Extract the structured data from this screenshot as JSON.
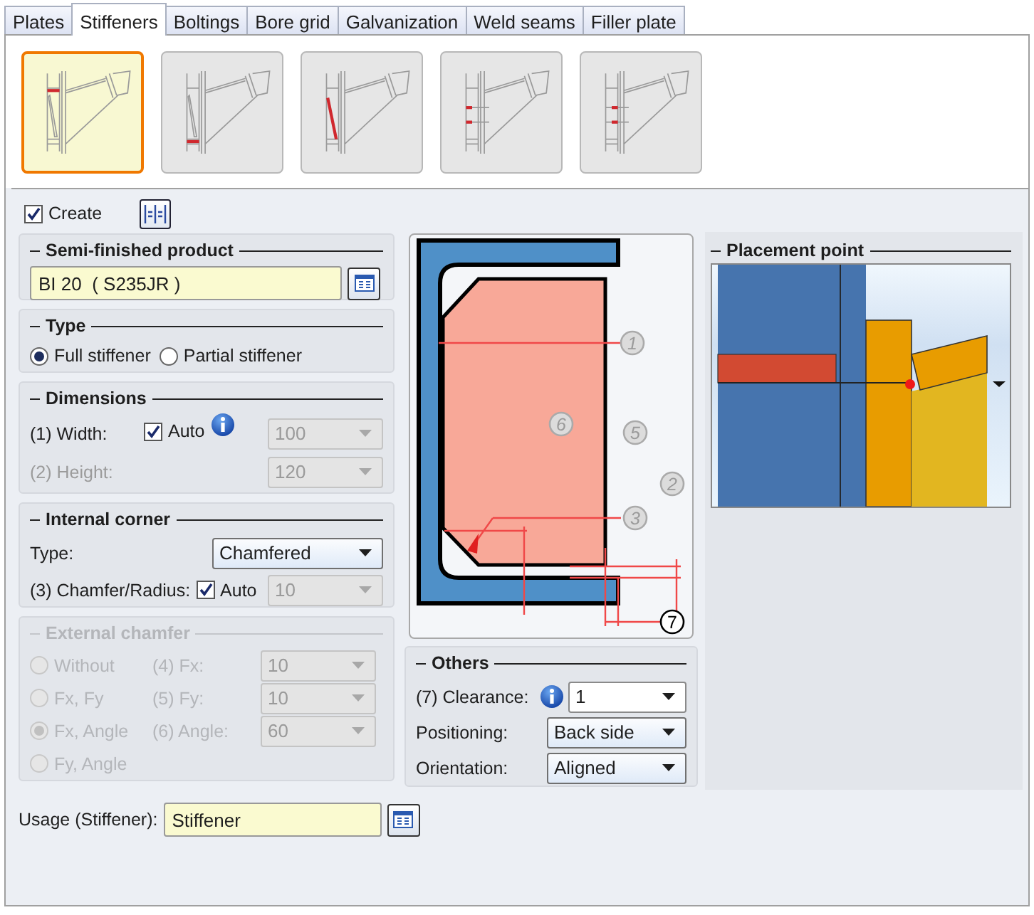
{
  "tabs": [
    {
      "label": "Plates",
      "selected": false
    },
    {
      "label": "Stiffeners",
      "selected": true
    },
    {
      "label": "Boltings",
      "selected": false
    },
    {
      "label": "Bore grid",
      "selected": false
    },
    {
      "label": "Galvanization",
      "selected": false
    },
    {
      "label": "Weld seams",
      "selected": false
    },
    {
      "label": "Filler plate",
      "selected": false
    }
  ],
  "variants": [
    {
      "kind": "top",
      "selected": true
    },
    {
      "kind": "bottom",
      "selected": false
    },
    {
      "kind": "diagonal",
      "selected": false
    },
    {
      "kind": "pair-left",
      "selected": false
    },
    {
      "kind": "pair-right",
      "selected": false
    }
  ],
  "create": {
    "label": "Create",
    "checked": true
  },
  "semi_finished_product": {
    "title": "Semi-finished product",
    "value": "BI 20  ( S235JR )"
  },
  "type": {
    "title": "Type",
    "options": [
      {
        "label": "Full stiffener",
        "selected": true
      },
      {
        "label": "Partial stiffener",
        "selected": false
      }
    ]
  },
  "dimensions": {
    "title": "Dimensions",
    "rows": [
      {
        "label": "(1) Width:",
        "disabled": false,
        "auto": {
          "label": "Auto",
          "checked": true
        },
        "value": "100",
        "value_disabled": true
      },
      {
        "label": "(2) Height:",
        "disabled": true,
        "value": "120",
        "value_disabled": true
      }
    ]
  },
  "internal_corner": {
    "title": "Internal corner",
    "type_label": "Type:",
    "type_value": "Chamfered",
    "size_label": "(3) Chamfer/Radius:",
    "auto": {
      "label": "Auto",
      "checked": true
    },
    "size_value": "10",
    "size_disabled": true
  },
  "external_chamfer": {
    "title": "External chamfer",
    "disabled": true,
    "options": [
      {
        "label": "Without",
        "selected": false
      },
      {
        "label": "Fx, Fy",
        "selected": false
      },
      {
        "label": "Fx, Angle",
        "selected": true
      },
      {
        "label": "Fy, Angle",
        "selected": false
      }
    ],
    "fields": [
      {
        "label": "(4) Fx:",
        "value": "10"
      },
      {
        "label": "(5) Fy:",
        "value": "10"
      },
      {
        "label": "(6) Angle:",
        "value": "60"
      }
    ]
  },
  "diagram": {
    "callouts": [
      {
        "label": "1",
        "highlighted": false
      },
      {
        "label": "6",
        "highlighted": false
      },
      {
        "label": "5",
        "highlighted": false
      },
      {
        "label": "2",
        "highlighted": false
      },
      {
        "label": "3",
        "highlighted": false
      },
      {
        "label": "7",
        "highlighted": true
      }
    ]
  },
  "others": {
    "title": "Others",
    "rows": [
      {
        "label": "(7) Clearance:",
        "value": "1",
        "info": true,
        "editable": true
      },
      {
        "label": "Positioning:",
        "value": "Back side",
        "info": false,
        "editable": false
      },
      {
        "label": "Orientation:",
        "value": "Aligned",
        "info": false,
        "editable": false
      }
    ]
  },
  "placement_point": {
    "title": "Placement point"
  },
  "usage": {
    "label": "Usage (Stiffener):",
    "value": "Stiffener"
  }
}
